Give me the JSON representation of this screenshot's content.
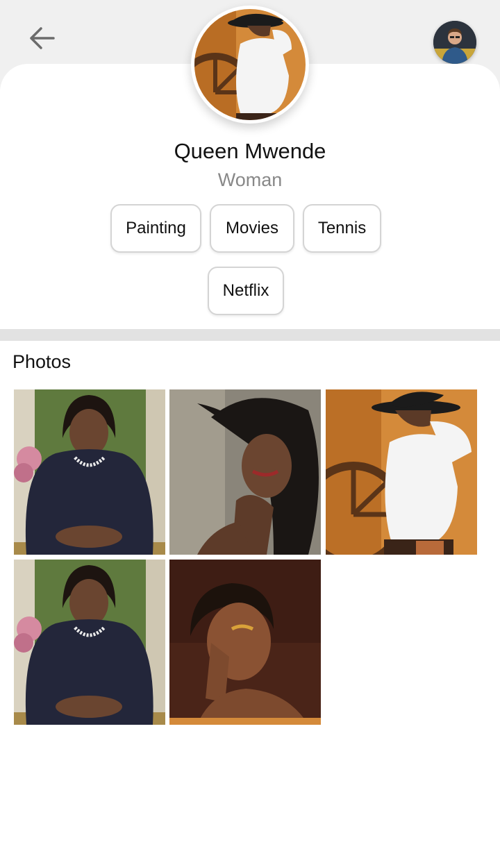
{
  "header": {
    "back_icon": "arrow-left-icon",
    "user_avatar_icon": "user-avatar"
  },
  "profile": {
    "name": "Queen Mwende",
    "gender": "Woman",
    "interests": [
      "Painting",
      "Movies",
      "Tennis",
      "Netflix"
    ]
  },
  "photos_section": {
    "title": "Photos",
    "count": 5
  },
  "colors": {
    "background": "#f0f0f0",
    "card": "#ffffff",
    "chip_border": "#d4d4d4",
    "secondary_text": "#888888",
    "divider": "#e2e2e2"
  }
}
